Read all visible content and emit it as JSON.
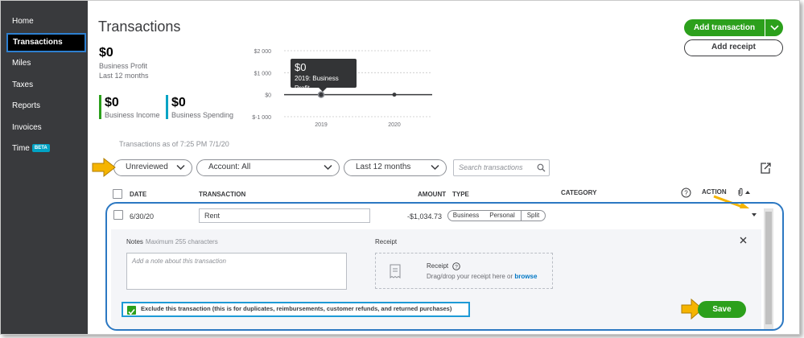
{
  "sidebar": {
    "items": [
      {
        "label": "Home"
      },
      {
        "label": "Transactions"
      },
      {
        "label": "Miles"
      },
      {
        "label": "Taxes"
      },
      {
        "label": "Reports"
      },
      {
        "label": "Invoices"
      },
      {
        "label": "Time",
        "badge": "BETA"
      }
    ]
  },
  "header": {
    "title": "Transactions",
    "add_transaction": "Add transaction",
    "add_receipt": "Add receipt"
  },
  "summary": {
    "profit_value": "$0",
    "profit_label": "Business Profit",
    "profit_period": "Last 12 months",
    "income_value": "$0",
    "income_label": "Business Income",
    "spending_value": "$0",
    "spending_label": "Business Spending",
    "income_color": "#2ca01c",
    "spending_color": "#00a3c4"
  },
  "chart_data": {
    "type": "line",
    "x": [
      "2019",
      "2020"
    ],
    "series": [
      {
        "values": [
          0,
          0
        ]
      }
    ],
    "y_ticks": [
      "$2 000",
      "$1 000",
      "$0",
      "$-1 000"
    ],
    "ylim": [
      -1000,
      2000
    ],
    "tooltip_value": "$0",
    "tooltip_label": "2019: Business Profit"
  },
  "as_of": "Transactions as of 7:25 PM 7/1/20",
  "filters": {
    "status": "Unreviewed",
    "account": "Account: All",
    "period": "Last 12 months",
    "search_placeholder": "Search transactions"
  },
  "table": {
    "columns": {
      "date": "DATE",
      "transaction": "TRANSACTION",
      "amount": "AMOUNT",
      "type": "TYPE",
      "category": "CATEGORY",
      "action": "ACTION"
    },
    "row": {
      "date": "6/30/20",
      "transaction": "Rent",
      "amount": "-$1,034.73",
      "type_options": [
        "Business",
        "Personal",
        "Split"
      ]
    }
  },
  "detail": {
    "notes_label": "Notes",
    "notes_hint": "Maximum 255 characters",
    "notes_placeholder": "Add a note about this transaction",
    "receipt_label": "Receipt",
    "receipt_title": "Receipt",
    "receipt_sub": "Drag/drop your receipt here or",
    "receipt_browse": "browse",
    "exclude_text": "Exclude this transaction (this is for duplicates, reimbursements, customer refunds, and returned purchases)",
    "exclude_checked": true,
    "save": "Save"
  }
}
